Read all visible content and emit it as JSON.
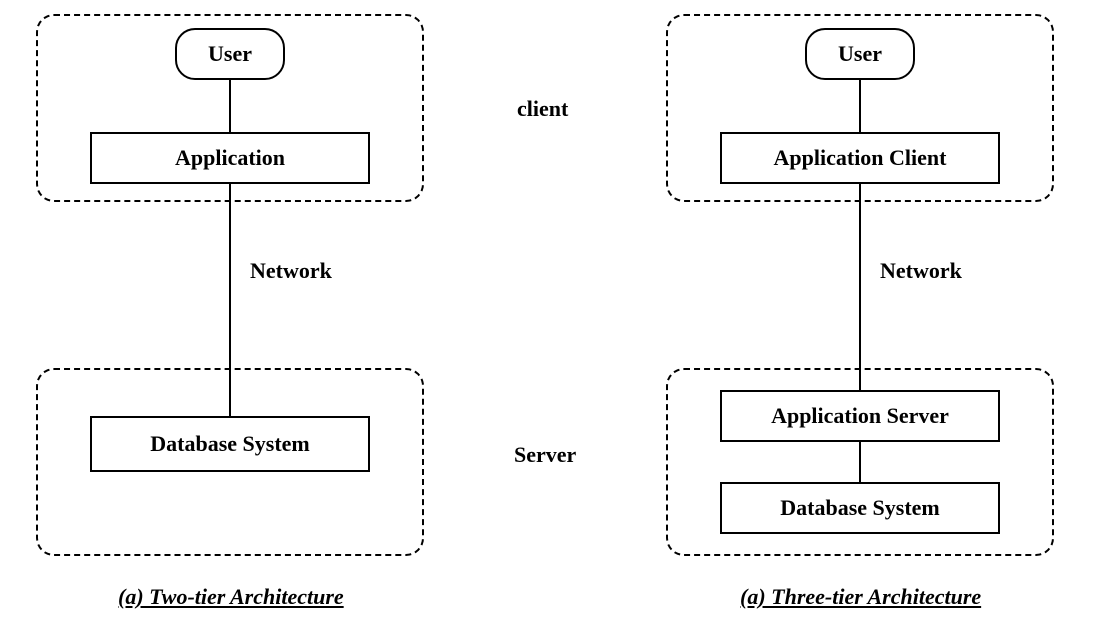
{
  "labels": {
    "client": "client",
    "server": "Server",
    "network_left": "Network",
    "network_right": "Network"
  },
  "left": {
    "user": "User",
    "app": "Application",
    "db": "Database System",
    "caption": "(a) Two-tier Architecture"
  },
  "right": {
    "user": "User",
    "app_client": "Application Client",
    "app_server": "Application Server",
    "db": "Database System",
    "caption": "(a) Three-tier Architecture"
  }
}
